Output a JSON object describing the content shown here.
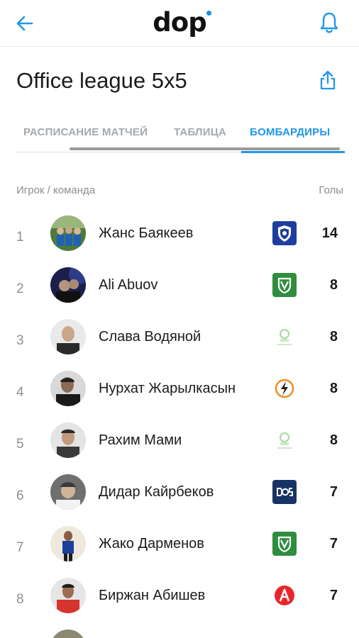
{
  "header": {
    "logo_text": "dop"
  },
  "league": {
    "title": "Office league 5x5"
  },
  "tabs": [
    {
      "label": "РАСПИСАНИЕ МАТЧЕЙ"
    },
    {
      "label": "ТАБЛИЦА"
    },
    {
      "label": "БОМБАРДИРЫ"
    }
  ],
  "columns": {
    "player": "Игрок / команда",
    "goals": "Голы"
  },
  "players": [
    {
      "rank": "1",
      "name": "Жанс Баякеев",
      "goals": "14",
      "team_icon": "shield-team-logo"
    },
    {
      "rank": "2",
      "name": "Ali Abuov",
      "goals": "8",
      "team_icon": "green-crest-team-logo"
    },
    {
      "rank": "3",
      "name": "Слава Водяной",
      "goals": "8",
      "team_icon": "light-green-team-logo"
    },
    {
      "rank": "4",
      "name": "Нурхат Жарылкасын",
      "goals": "8",
      "team_icon": "lightning-team-logo"
    },
    {
      "rank": "5",
      "name": "Рахим Мами",
      "goals": "8",
      "team_icon": "light-green-team-logo"
    },
    {
      "rank": "6",
      "name": "Дидар Кайрбеков",
      "goals": "7",
      "team_icon": "dos-team-logo"
    },
    {
      "rank": "7",
      "name": "Жако Дарменов",
      "goals": "7",
      "team_icon": "green-crest-team-logo"
    },
    {
      "rank": "8",
      "name": "Биржан Абишев",
      "goals": "7",
      "team_icon": "red-a-team-logo"
    }
  ],
  "colors": {
    "accent": "#2196e6",
    "tab_inactive": "#a3a9ad",
    "text": "#1b1b1b",
    "muted": "#8d8d8d"
  }
}
